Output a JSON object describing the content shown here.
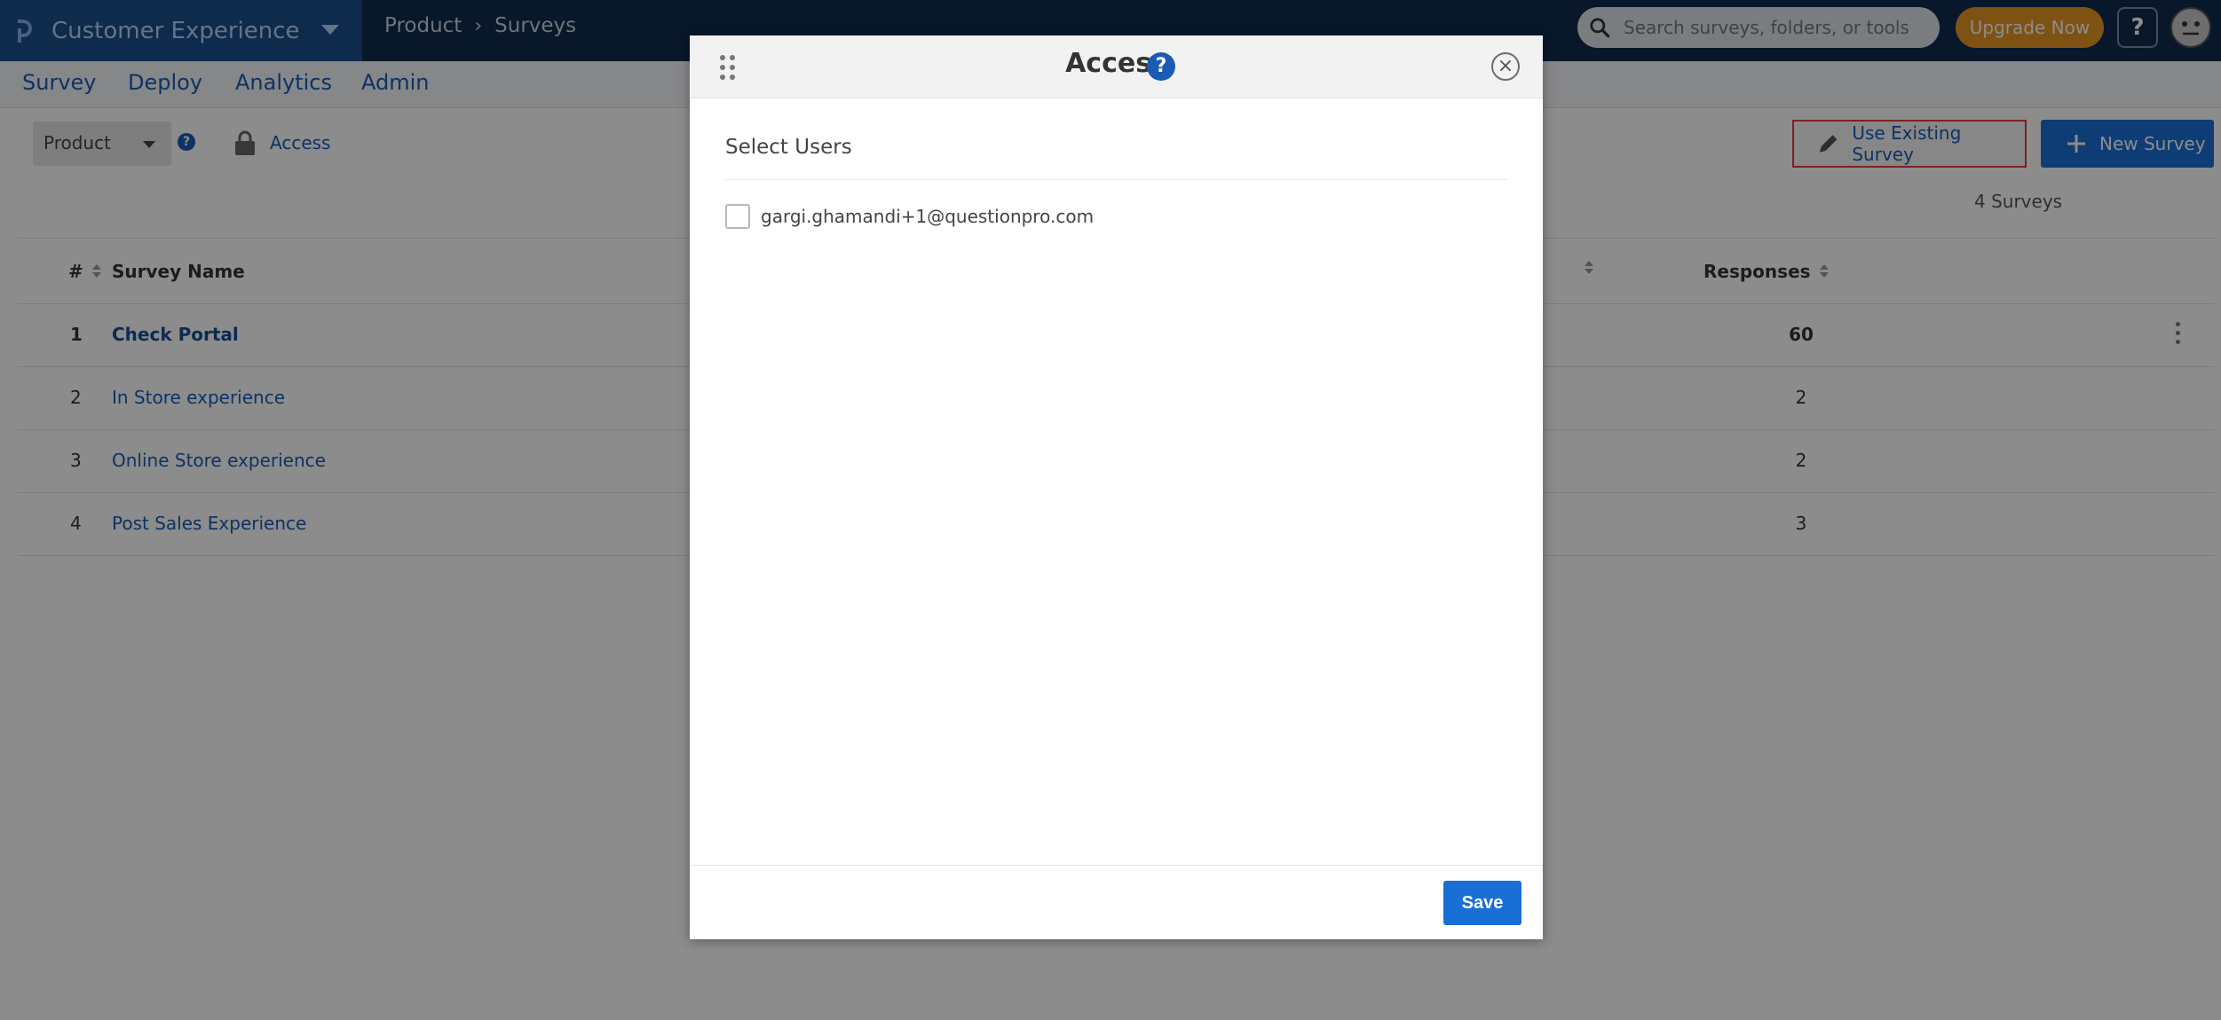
{
  "app": {
    "name": "Customer Experience"
  },
  "breadcrumb": {
    "parent": "Product",
    "separator": "›",
    "current": "Surveys"
  },
  "search": {
    "placeholder": "Search surveys, folders, or tools"
  },
  "header": {
    "upgrade_label": "Upgrade Now",
    "help_label": "?"
  },
  "nav": {
    "items": [
      "Survey",
      "Deploy",
      "Analytics",
      "Admin"
    ]
  },
  "toolbar": {
    "folder_select": "Product",
    "access_label": "Access",
    "use_existing_label": "Use Existing Survey",
    "new_survey_label": "New Survey",
    "survey_count": "4 Surveys"
  },
  "table": {
    "columns": {
      "number": "#",
      "name": "Survey Name",
      "responses": "Responses"
    },
    "rows": [
      {
        "num": "1",
        "name": "Check Portal",
        "responses": "60"
      },
      {
        "num": "2",
        "name": "In Store experience",
        "responses": "2"
      },
      {
        "num": "3",
        "name": "Online Store experience",
        "responses": "2"
      },
      {
        "num": "4",
        "name": "Post Sales Experience",
        "responses": "3"
      }
    ]
  },
  "modal": {
    "title": "Access",
    "help_label": "?",
    "close_label": "×",
    "section_title": "Select Users",
    "users": [
      {
        "email": "gargi.ghamandi+1@questionpro.com",
        "checked": false
      }
    ],
    "save_label": "Save"
  },
  "colors": {
    "topbar": "#0f2a4d",
    "brand": "#1b4e8d",
    "accent": "#1a6fd6",
    "upgrade": "#e69524",
    "highlight_border": "#e23c3c"
  },
  "icons": [
    "app-logo-icon",
    "caret-down-icon",
    "search-icon",
    "help-icon",
    "avatar-icon",
    "lock-icon",
    "pencil-icon",
    "plus-icon",
    "sort-icon",
    "kebab-icon",
    "drag-handle-icon",
    "close-icon"
  ]
}
